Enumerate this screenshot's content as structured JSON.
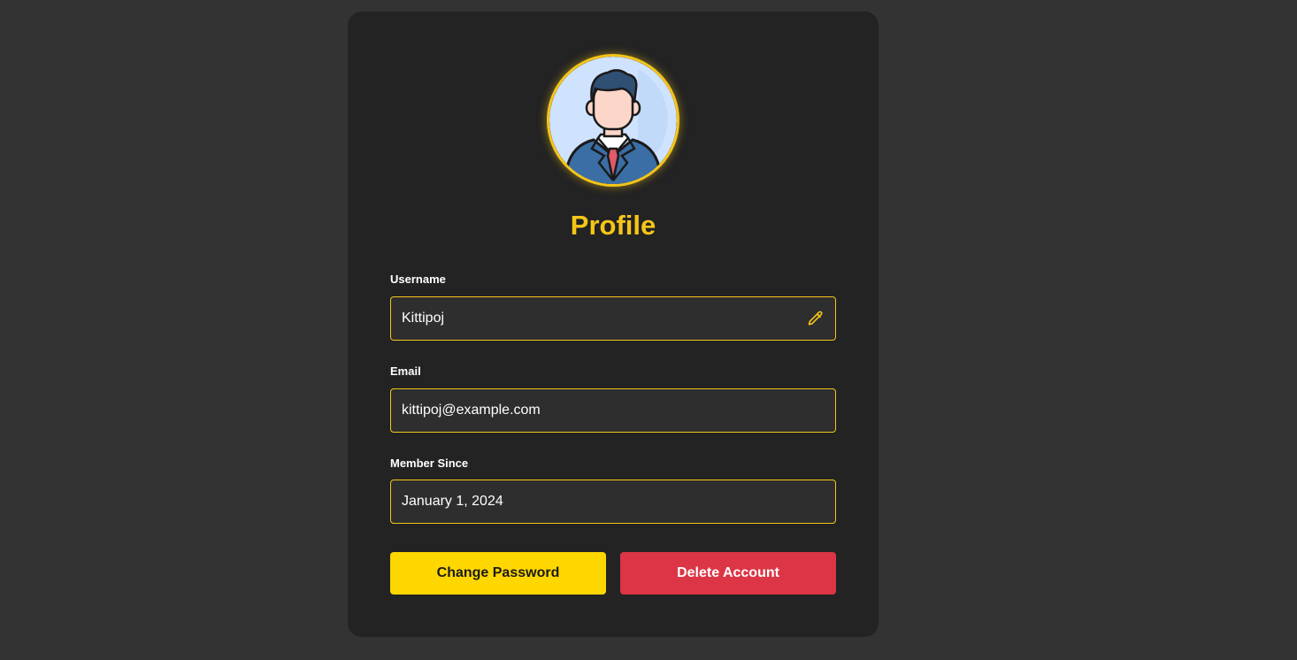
{
  "profile": {
    "title": "Profile",
    "avatar_icon": "businessman-avatar-icon"
  },
  "fields": {
    "username": {
      "label": "Username",
      "value": "Kittipoj",
      "icon": "pencil-icon"
    },
    "email": {
      "label": "Email",
      "value": "kittipoj@example.com"
    },
    "member_since": {
      "label": "Member Since",
      "value": "January 1, 2024"
    }
  },
  "actions": {
    "change_password": "Change Password",
    "delete_account": "Delete Account"
  },
  "colors": {
    "background": "#333333",
    "card": "#232323",
    "accent": "#f5c518",
    "primary_button": "#ffd700",
    "danger_button": "#dc3545"
  }
}
